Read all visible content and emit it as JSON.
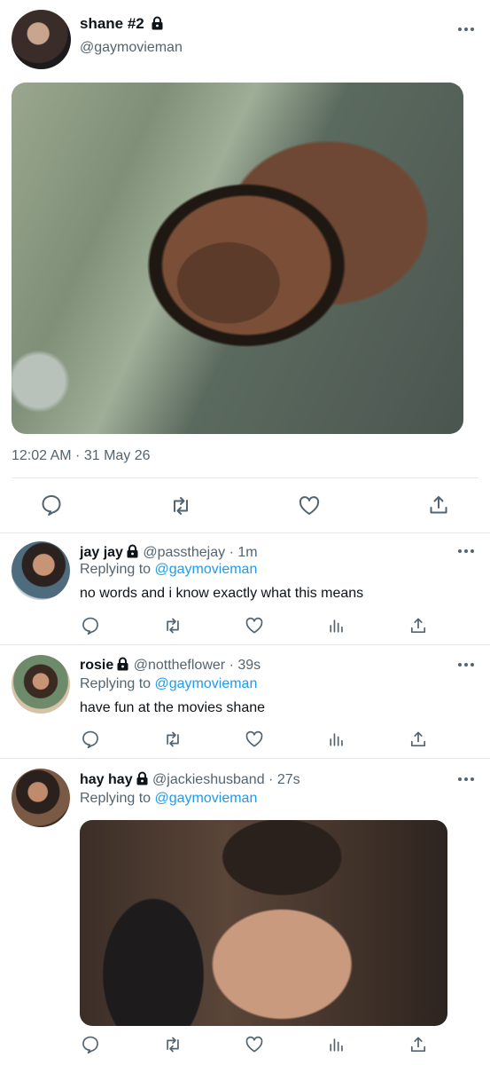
{
  "main_tweet": {
    "display_name": "shane #2",
    "handle": "@gaymovieman",
    "timestamp": "12:02 AM · 31 May 26",
    "icons": [
      "lock-icon",
      "more-icon",
      "reply-icon",
      "retweet-icon",
      "like-icon",
      "share-icon"
    ]
  },
  "replies": [
    {
      "display_name": "jay jay",
      "handle": "@passthejay",
      "age": "· 1m",
      "replying_prefix": "Replying to ",
      "replying_to": "@gaymovieman",
      "text": "no words and i know exactly what this means"
    },
    {
      "display_name": "rosie",
      "handle": "@nottheflower",
      "age": "· 39s",
      "replying_prefix": "Replying to ",
      "replying_to": "@gaymovieman",
      "text": "have fun at the movies shane"
    },
    {
      "display_name": "hay hay",
      "handle": "@jackieshusband",
      "age": "· 27s",
      "replying_prefix": "Replying to ",
      "replying_to": "@gaymovieman",
      "text": ""
    }
  ],
  "colors": {
    "text": "#0f1419",
    "secondary": "#536471",
    "link": "#1d9bf0",
    "divider": "#e6e9ec"
  }
}
